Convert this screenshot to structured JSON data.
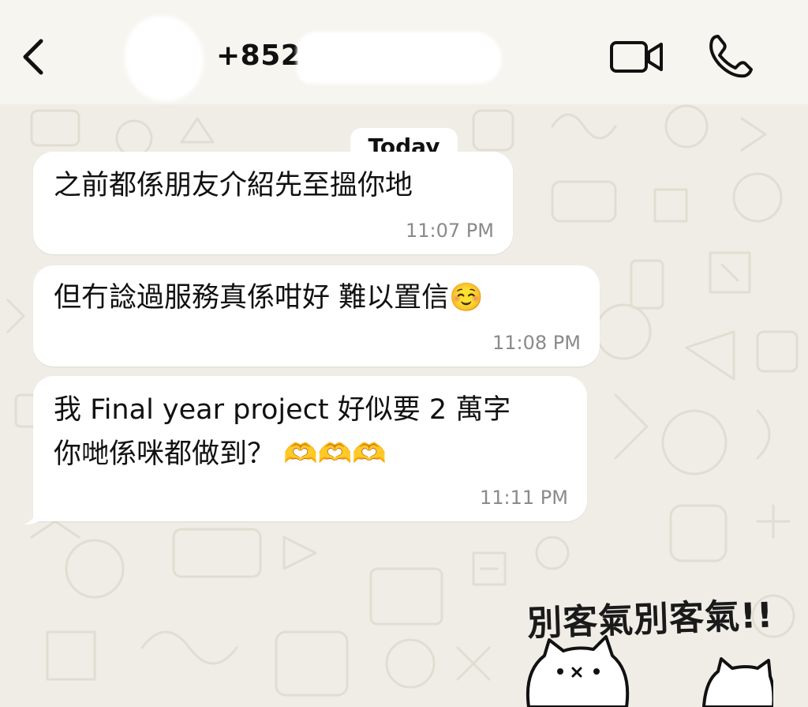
{
  "header": {
    "back_icon": "chevron-left-icon",
    "contact_name": "+852",
    "video_icon": "video-camera-icon",
    "call_icon": "phone-icon"
  },
  "chat": {
    "date_label": "Today",
    "messages": [
      {
        "lines": [
          "之前都係朋友介紹先至搵你地"
        ],
        "time": "11:07 PM"
      },
      {
        "lines": [
          "但冇諗過服務真係咁好 難以置信☺️"
        ],
        "time": "11:08 PM"
      },
      {
        "lines": [
          "我 Final year project 好似要 2 萬字",
          "你哋係咪都做到？ 🫶🫶🫶"
        ],
        "time": "11:11 PM"
      }
    ]
  },
  "sticker": {
    "text": "別客氣別客氣!!",
    "icon": "cat-sticker-icon"
  },
  "colors": {
    "background": "#f0ede6",
    "bubble": "#ffffff",
    "time": "#8a8a8a"
  }
}
